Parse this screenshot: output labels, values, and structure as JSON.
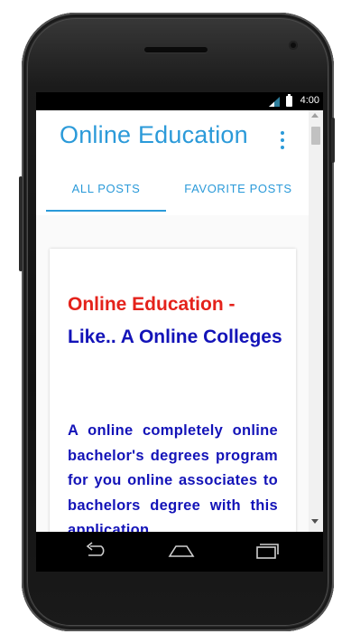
{
  "status_bar": {
    "time": "4:00",
    "signal_icon": "signal-icon",
    "battery_icon": "battery-icon"
  },
  "app_bar": {
    "title": "Online Education",
    "menu_icon": "more-vert-icon"
  },
  "tabs": [
    {
      "label": "ALL POSTS",
      "selected": true
    },
    {
      "label": "FAVORITE POSTS",
      "selected": false
    }
  ],
  "post": {
    "title_part1": "Online Education -",
    "title_part2": "Like.. A Online Colleges",
    "body": "A online completely online bachelor's degrees program for you online associates to bachelors degree with this application"
  },
  "nav_bar": {
    "back_icon": "back-icon",
    "home_icon": "home-icon",
    "recents_icon": "recents-icon"
  },
  "colors": {
    "accent": "#2b9ad9",
    "title_red": "#e4221b",
    "text_blue": "#1313b8"
  }
}
